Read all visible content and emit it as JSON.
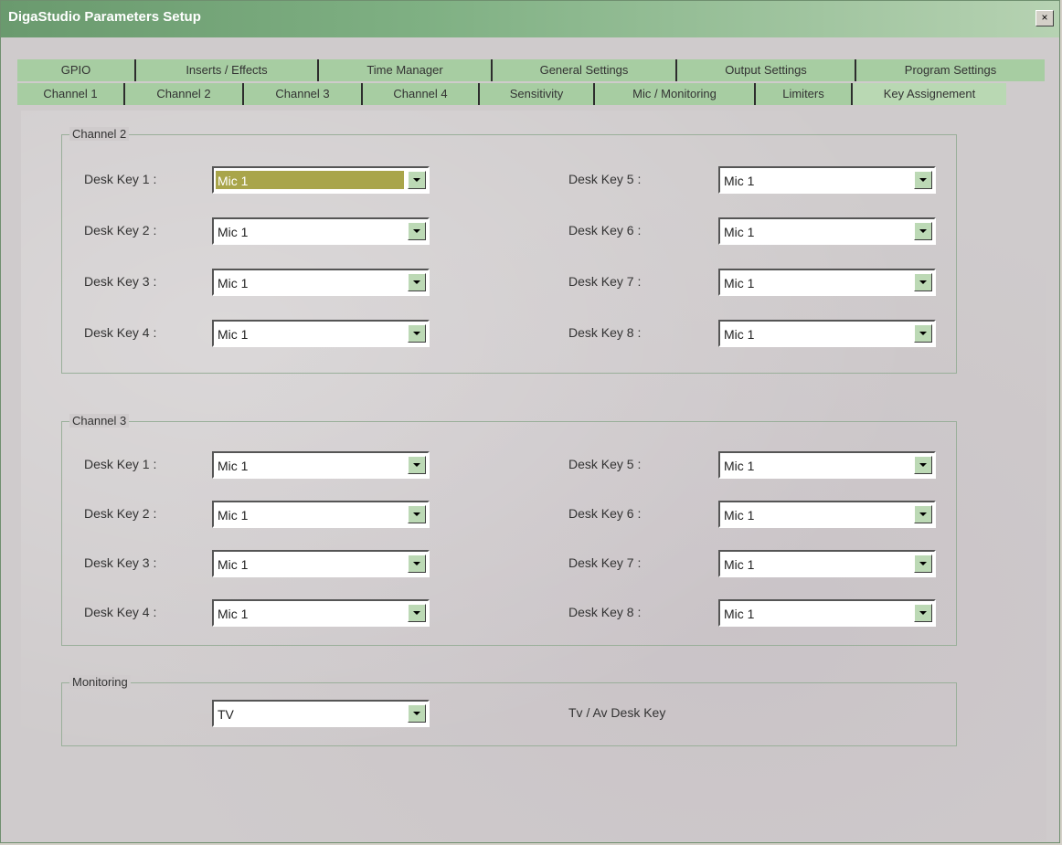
{
  "window": {
    "title": "DigaStudio Parameters Setup",
    "close_label": "×"
  },
  "tabs_back": [
    "GPIO",
    "Inserts / Effects",
    "Time Manager",
    "General Settings",
    "Output Settings",
    "Program Settings"
  ],
  "tabs_front": [
    "Channel 1",
    "Channel 2",
    "Channel 3",
    "Channel 4",
    "Sensitivity",
    "Mic / Monitoring",
    "Limiters",
    "Key Assignement"
  ],
  "active_tab": "Key Assignement",
  "groups": {
    "ch2": {
      "legend": "Channel 2",
      "left_labels": [
        "Desk Key 1 :",
        "Desk Key 2 :",
        "Desk Key 3 :",
        "Desk Key 4 :"
      ],
      "right_labels": [
        "Desk Key 5 :",
        "Desk Key 6 :",
        "Desk Key 7 :",
        "Desk Key 8 :"
      ],
      "left_values": [
        "Mic 1",
        "Mic 1",
        "Mic 1",
        "Mic 1"
      ],
      "right_values": [
        "Mic 1",
        "Mic 1",
        "Mic 1",
        "Mic 1"
      ]
    },
    "ch3": {
      "legend": "Channel 3",
      "left_labels": [
        "Desk Key 1 :",
        "Desk Key 2 :",
        "Desk Key 3 :",
        "Desk Key 4 :"
      ],
      "right_labels": [
        "Desk Key 5 :",
        "Desk Key 6 :",
        "Desk Key 7 :",
        "Desk Key 8 :"
      ],
      "left_values": [
        "Mic 1",
        "Mic 1",
        "Mic 1",
        "Mic 1"
      ],
      "right_values": [
        "Mic 1",
        "Mic 1",
        "Mic 1",
        "Mic 1"
      ]
    },
    "monitoring": {
      "legend": "Monitoring",
      "value": "TV",
      "description": "Tv / Av Desk Key"
    }
  },
  "colors": {
    "titlebar": "#6a9a6e",
    "tab": "#a7cda2",
    "selected_highlight": "#a9a54a"
  }
}
